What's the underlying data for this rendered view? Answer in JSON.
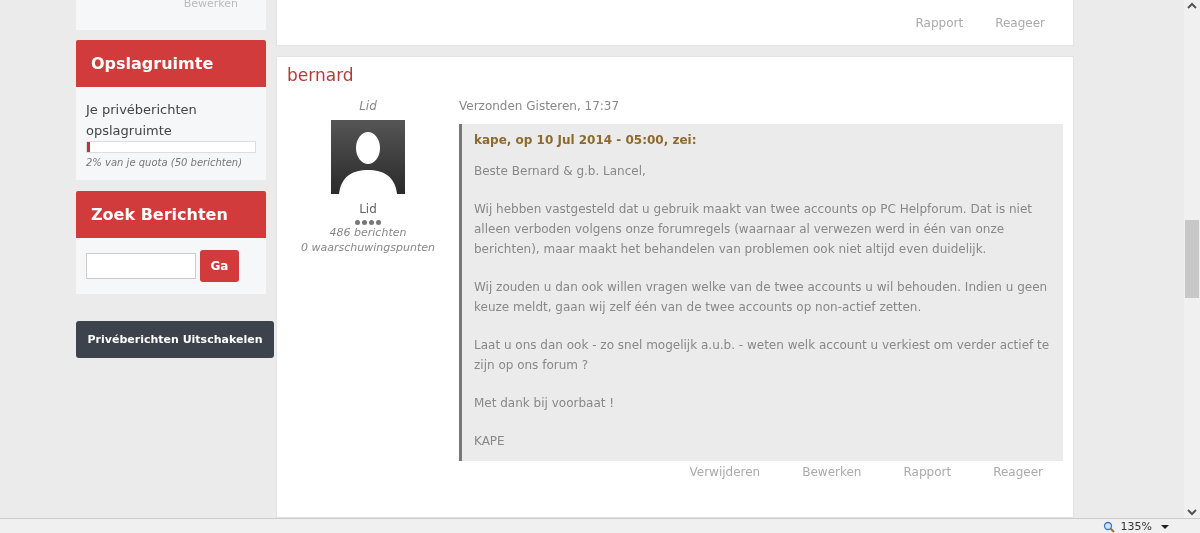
{
  "sidebar": {
    "top_link": "Bewerken",
    "storage": {
      "title": "Opslagruimte",
      "label": "Je privéberichten opslagruimte",
      "level": 0.02,
      "quota": "2% van je quota (50 berichten)"
    },
    "search": {
      "title": "Zoek Berichten",
      "button": "Ga"
    },
    "disable_button": "Privéberichten Uitschakelen"
  },
  "previous_post": {
    "actions": [
      "Rapport",
      "Reageer"
    ]
  },
  "post": {
    "author": "bernard",
    "group_title": "Lid",
    "group": "Lid",
    "posts": "486 berichten",
    "warnings": "0 waarschuwingspunten",
    "sent": "Verzonden Gisteren, 17:37",
    "quote": {
      "citation": "kape, op 10 Jul 2014 - 05:00, zei:",
      "paragraphs": [
        "Beste Bernard & g.b. Lancel,",
        "Wij hebben vastgesteld dat u gebruik maakt van twee accounts op PC Helpforum. Dat is niet alleen verboden volgens onze forumregels (waarnaar al verwezen werd in één van onze berichten), maar maakt het behandelen van problemen ook niet altijd even duidelijk.",
        "Wij zouden u dan ook willen vragen welke van de twee accounts u wil behouden. Indien u geen keuze meldt, gaan wij zelf één van de twee accounts op non-actief zetten.",
        "Laat u ons dan ook - zo snel mogelijk a.u.b. - weten welk account u verkiest om verder actief te zijn op ons forum ?",
        "Met dank bij voorbaat !",
        "KAPE"
      ]
    },
    "actions": [
      "Verwijderen",
      "Bewerken",
      "Rapport",
      "Reageer"
    ]
  },
  "status_bar": {
    "zoom": "135%"
  }
}
